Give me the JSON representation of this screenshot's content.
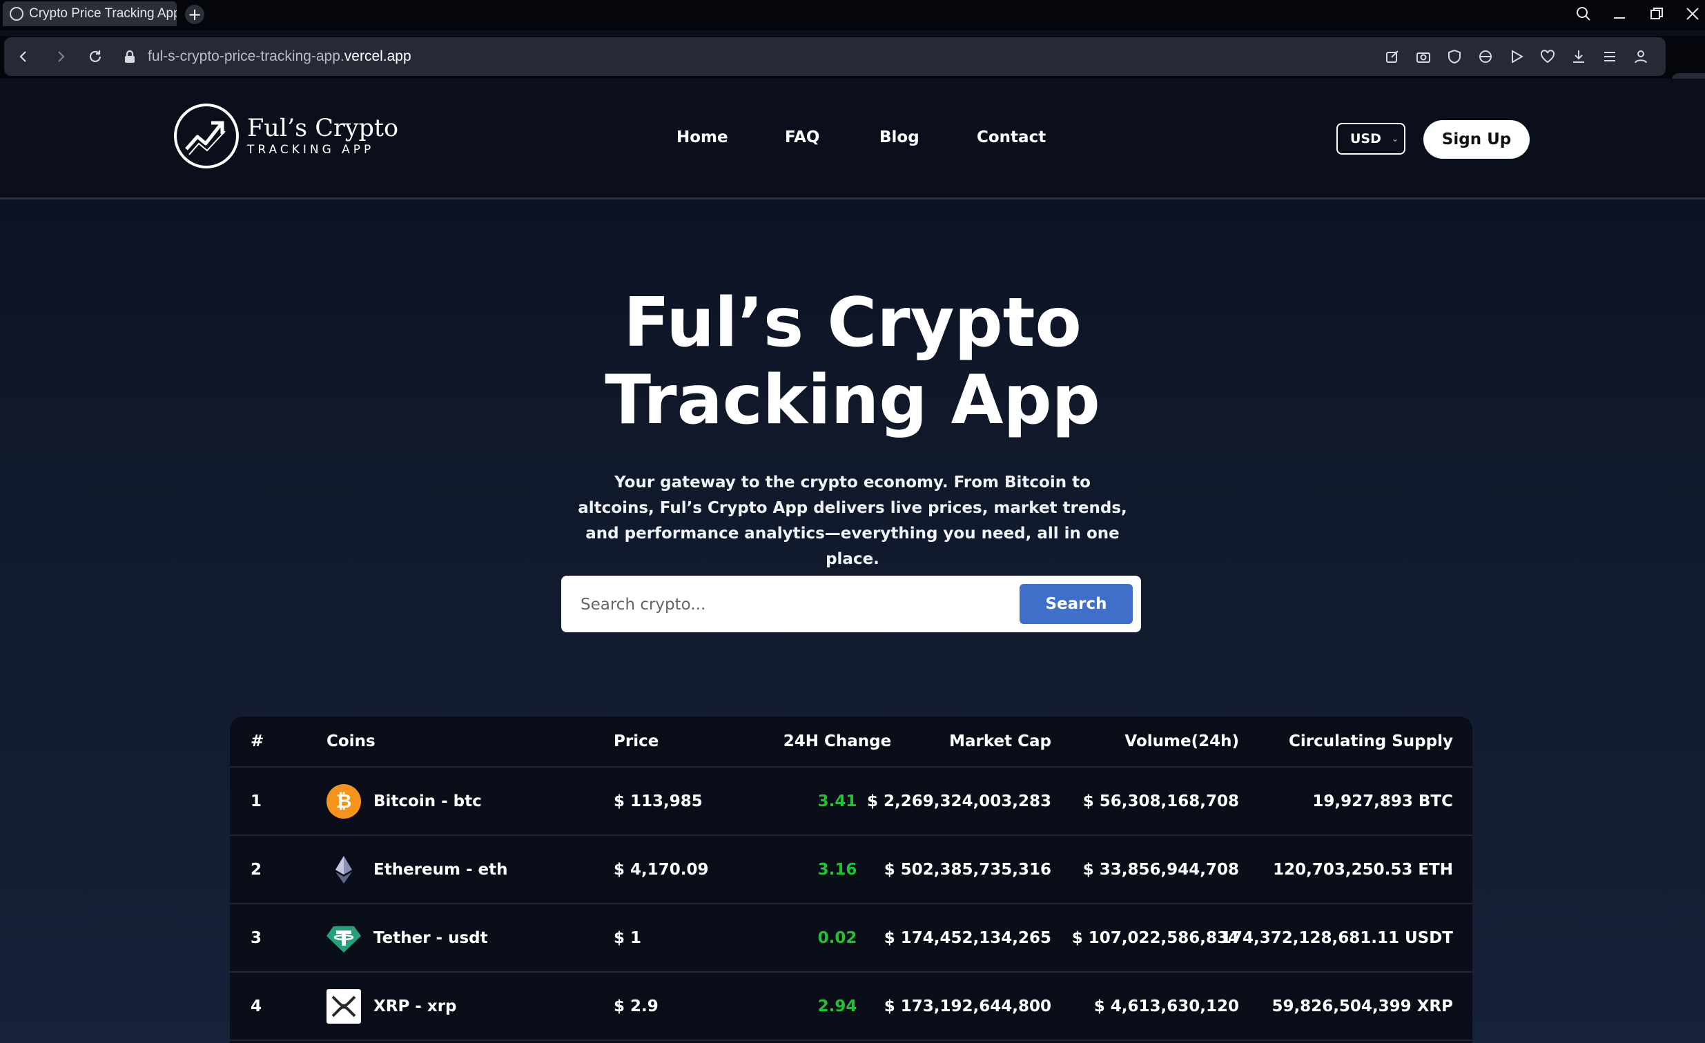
{
  "browser": {
    "tab_title": "Crypto Price Tracking App",
    "new_tab": "+",
    "url_path": "ful-s-crypto-price-tracking-app.",
    "url_domain": "vercel.app"
  },
  "header": {
    "logo_title": "Ful’s Crypto",
    "logo_subtitle": "TRACKING APP",
    "nav": [
      "Home",
      "FAQ",
      "Blog",
      "Contact"
    ],
    "currency": "USD",
    "signup": "Sign Up"
  },
  "hero": {
    "title_line1": "Ful’s Crypto",
    "title_line2": "Tracking App",
    "description": "Your gateway to the crypto economy. From Bitcoin to altcoins, Ful’s Crypto App delivers live prices, market trends, and performance analytics—everything you need, all in one place.",
    "search_placeholder": "Search crypto...",
    "search_button": "Search"
  },
  "table": {
    "headers": [
      "#",
      "Coins",
      "Price",
      "24H Change",
      "Market Cap",
      "Volume(24h)",
      "Circulating Supply"
    ],
    "rows": [
      {
        "rank": "1",
        "coin": "Bitcoin - btc",
        "icon": "bitcoin-icon",
        "price": "$ 113,985",
        "change": "3.41",
        "market_cap": "$ 2,269,324,003,283",
        "volume": "$ 56,308,168,708",
        "supply": "19,927,893 BTC"
      },
      {
        "rank": "2",
        "coin": "Ethereum - eth",
        "icon": "ethereum-icon",
        "price": "$ 4,170.09",
        "change": "3.16",
        "market_cap": "$ 502,385,735,316",
        "volume": "$ 33,856,944,708",
        "supply": "120,703,250.53 ETH"
      },
      {
        "rank": "3",
        "coin": "Tether - usdt",
        "icon": "tether-icon",
        "price": "$ 1",
        "change": "0.02",
        "market_cap": "$ 174,452,134,265",
        "volume": "$ 107,022,586,834",
        "supply": "174,372,128,681.11 USDT"
      },
      {
        "rank": "4",
        "coin": "XRP - xrp",
        "icon": "xrp-icon",
        "price": "$ 2.9",
        "change": "2.94",
        "market_cap": "$ 173,192,644,800",
        "volume": "$ 4,613,630,120",
        "supply": "59,826,504,399 XRP"
      }
    ]
  },
  "colors": {
    "accent_blue": "#3f6fc9",
    "positive_green": "#22c232",
    "bitcoin_orange": "#f7931a",
    "tether_teal": "#26a17b"
  }
}
